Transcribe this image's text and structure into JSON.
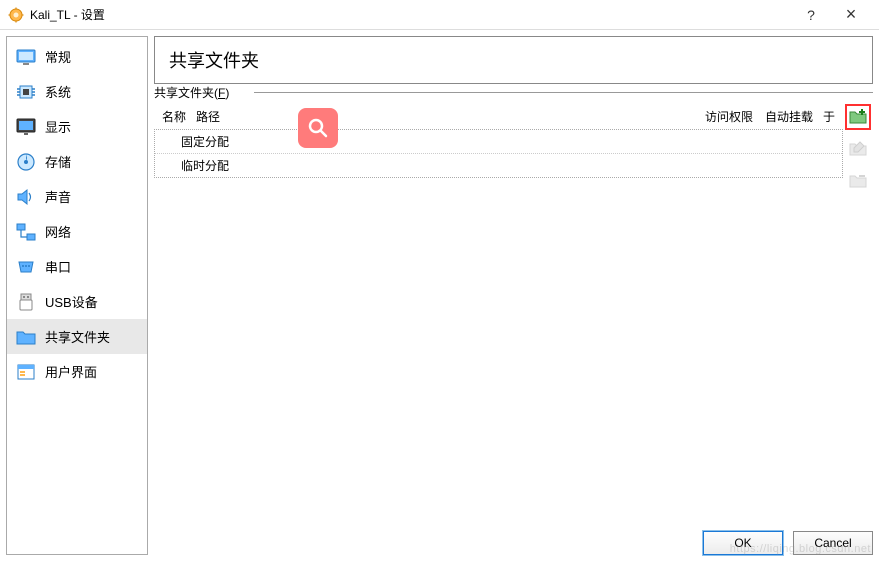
{
  "window": {
    "title": "Kali_TL - 设置",
    "help_symbol": "?",
    "close_symbol": "×"
  },
  "sidebar": {
    "items": [
      {
        "label": "常规"
      },
      {
        "label": "系统"
      },
      {
        "label": "显示"
      },
      {
        "label": "存储"
      },
      {
        "label": "声音"
      },
      {
        "label": "网络"
      },
      {
        "label": "串口"
      },
      {
        "label": "USB设备"
      },
      {
        "label": "共享文件夹"
      },
      {
        "label": "用户界面"
      }
    ]
  },
  "main": {
    "title": "共享文件夹",
    "legend_prefix": "共享文件夹(",
    "legend_key": "F",
    "legend_suffix": ")",
    "columns": {
      "name": "名称",
      "path": "路径",
      "access": "访问权限",
      "automount": "自动挂载",
      "at": "于"
    },
    "rows": [
      {
        "label": "固定分配"
      },
      {
        "label": "临时分配"
      }
    ]
  },
  "footer": {
    "ok": "OK",
    "cancel": "Cancel"
  },
  "watermark": "https://liqing.blog.csdn.net"
}
